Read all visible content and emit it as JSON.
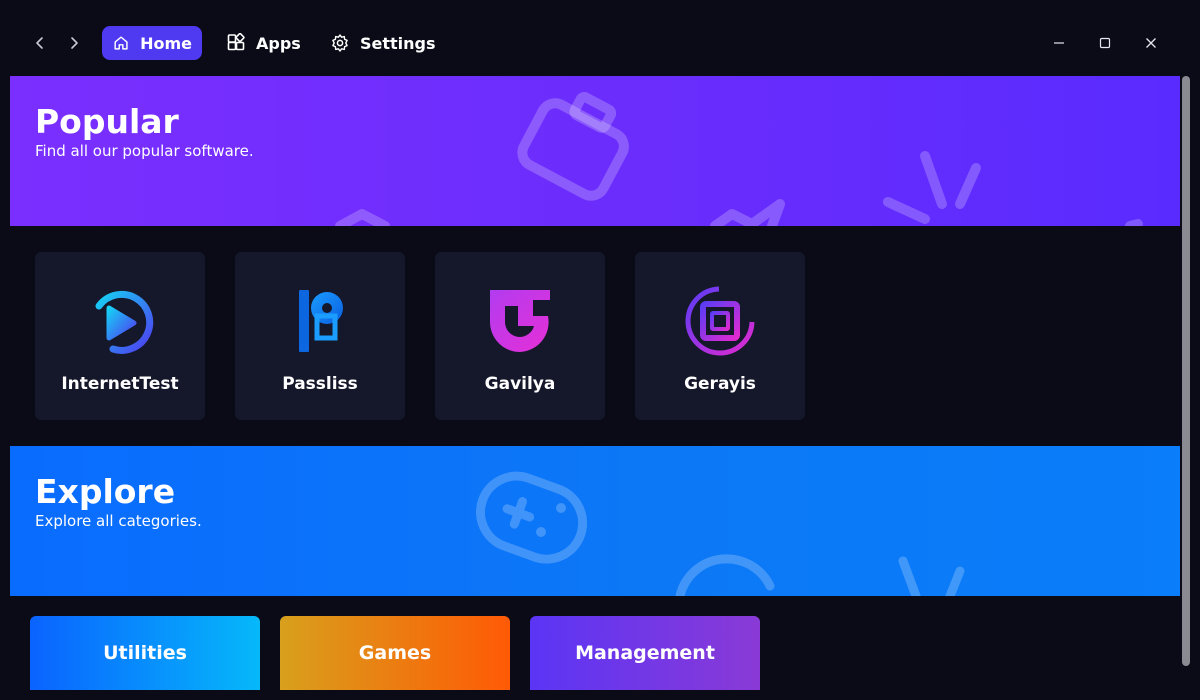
{
  "titlebar": {
    "tabs": [
      {
        "label": "Home",
        "icon": "home-icon"
      },
      {
        "label": "Apps",
        "icon": "apps-grid-icon"
      },
      {
        "label": "Settings",
        "icon": "gear-icon"
      }
    ],
    "active_tab": "Home",
    "accent_color": "#4f3af2"
  },
  "popular": {
    "title": "Popular",
    "subtitle": "Find all our popular software.",
    "apps": [
      {
        "name": "InternetTest",
        "icon": "internettest-logo"
      },
      {
        "name": "Passliss",
        "icon": "passliss-logo"
      },
      {
        "name": "Gavilya",
        "icon": "gavilya-logo"
      },
      {
        "name": "Gerayis",
        "icon": "gerayis-logo"
      }
    ]
  },
  "explore": {
    "title": "Explore",
    "subtitle": "Explore all categories.",
    "categories": [
      {
        "label": "Utilities"
      },
      {
        "label": "Games"
      },
      {
        "label": "Management"
      }
    ]
  },
  "colors": {
    "background": "#0a0b17",
    "card": "#15172a",
    "popular_banner": "#7a2fff",
    "explore_banner": "#0a6cff"
  }
}
